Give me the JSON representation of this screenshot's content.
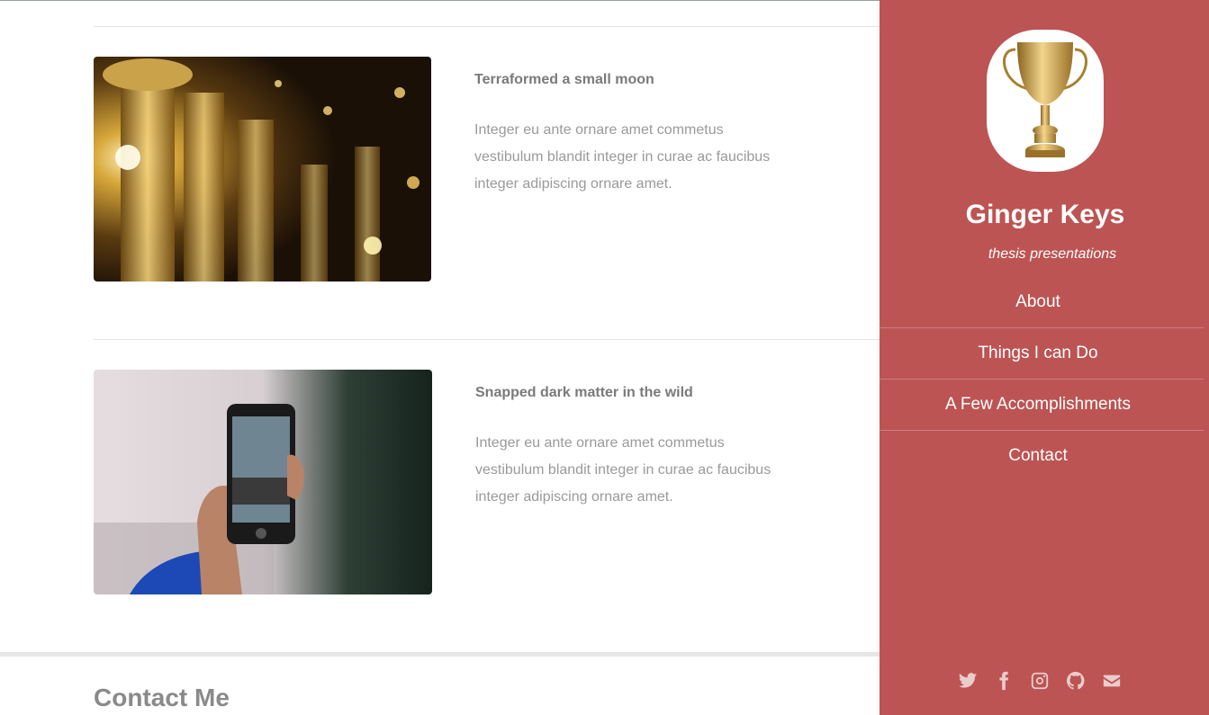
{
  "accomplishments": [
    {
      "title": "Terraformed a small moon",
      "description": "Integer eu ante ornare amet commetus vestibulum blandit integer in curae ac faucibus integer adipiscing ornare amet.",
      "image": "trophies-photo"
    },
    {
      "title": "Snapped dark matter in the wild",
      "description": "Integer eu ante ornare amet commetus vestibulum blandit integer in curae ac faucibus integer adipiscing ornare amet.",
      "image": "phone-photo"
    }
  ],
  "contact": {
    "heading": "Contact Me"
  },
  "sidebar": {
    "name": "Ginger Keys",
    "tagline": "thesis presentations",
    "nav": [
      "About",
      "Things I can Do",
      "A Few Accomplishments",
      "Contact"
    ],
    "social": [
      "twitter-icon",
      "facebook-icon",
      "instagram-icon",
      "github-icon",
      "envelope-icon"
    ],
    "background_color": "#bc5453"
  }
}
